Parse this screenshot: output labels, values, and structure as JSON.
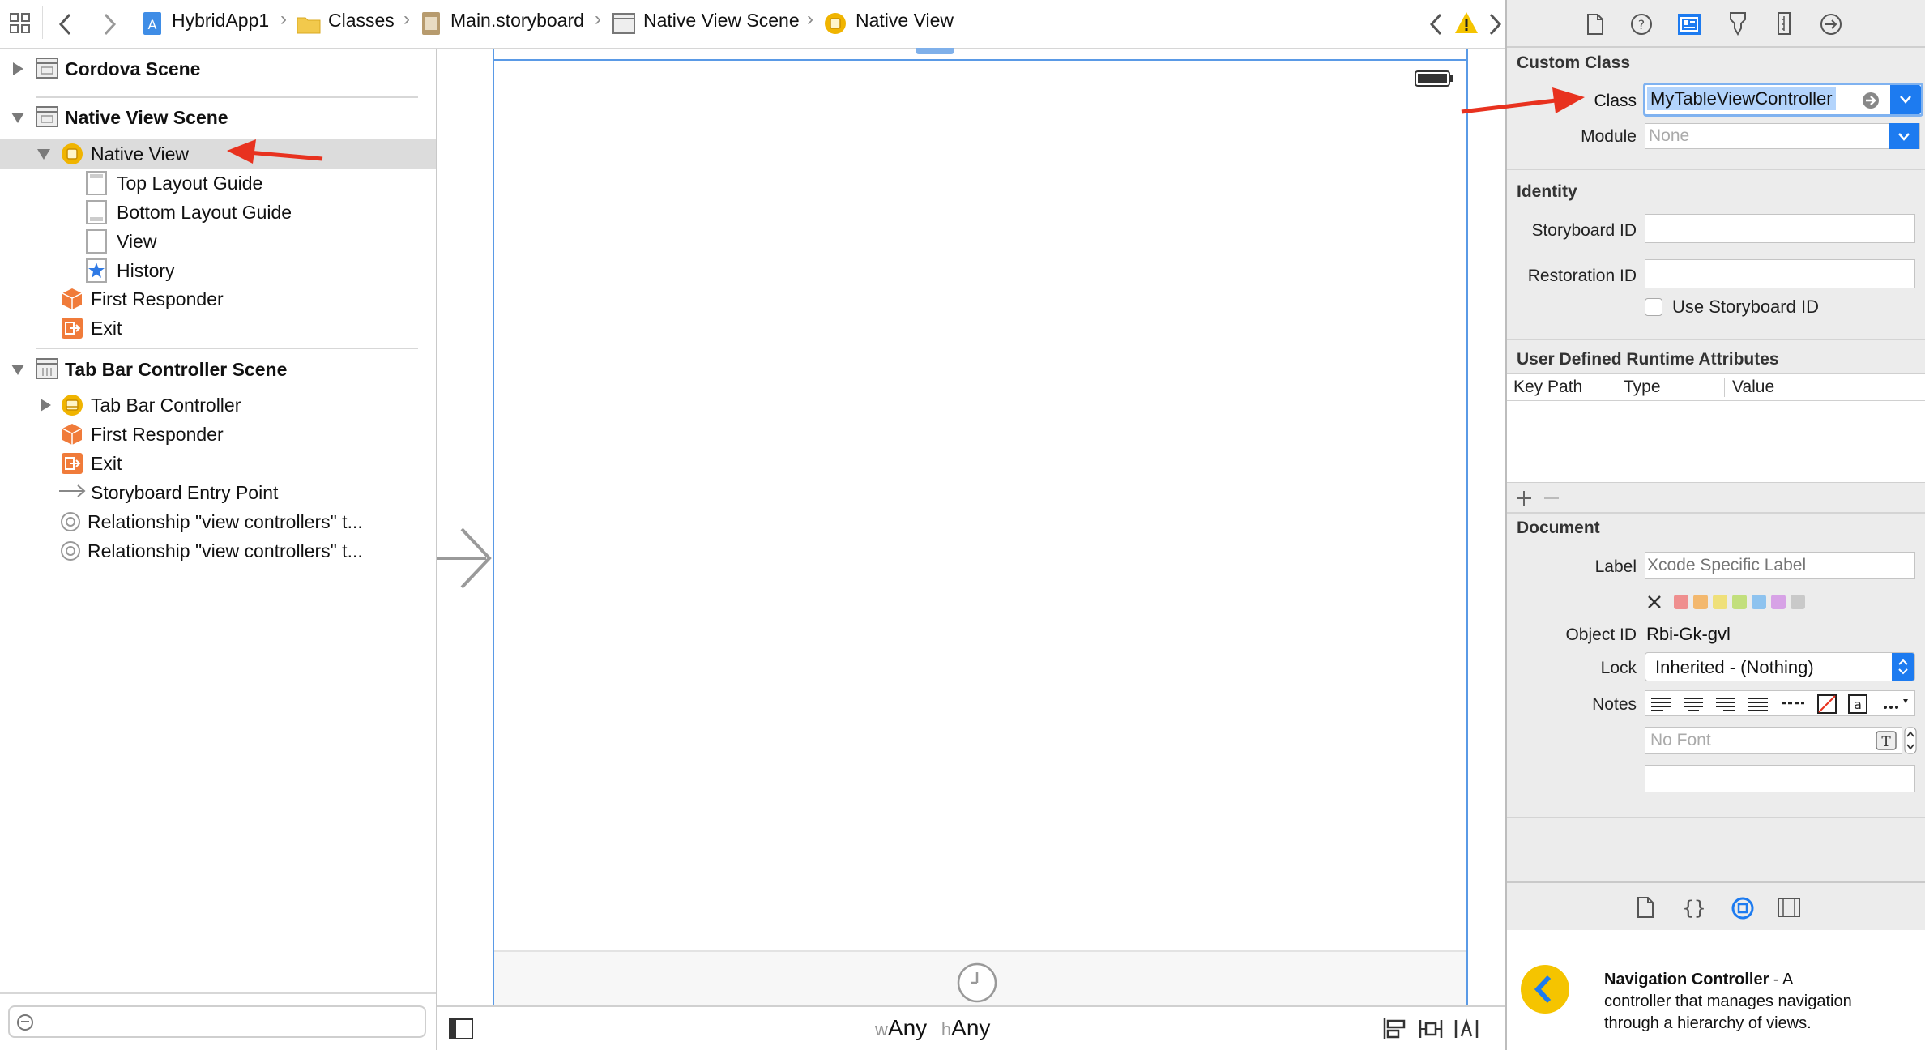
{
  "breadcrumb": {
    "items": [
      "HybridApp1",
      "Classes",
      "Main.storyboard",
      "Native View Scene",
      "Native View"
    ]
  },
  "outline": {
    "rows": [
      {
        "label": "Cordova Scene"
      },
      {
        "label": "Native View Scene"
      },
      {
        "label": "Native View"
      },
      {
        "label": "Top Layout Guide"
      },
      {
        "label": "Bottom Layout Guide"
      },
      {
        "label": "View"
      },
      {
        "label": "History"
      },
      {
        "label": "First Responder"
      },
      {
        "label": "Exit"
      },
      {
        "label": "Tab Bar Controller Scene"
      },
      {
        "label": "Tab Bar Controller"
      },
      {
        "label": "First Responder"
      },
      {
        "label": "Exit"
      },
      {
        "label": "Storyboard Entry Point"
      },
      {
        "label": "Relationship \"view controllers\" t..."
      },
      {
        "label": "Relationship \"view controllers\" t..."
      }
    ],
    "filter_placeholder": ""
  },
  "canvas": {
    "size_class_w": "w",
    "size_class_w_value": "Any",
    "size_class_h": "h",
    "size_class_h_value": "Any"
  },
  "inspector": {
    "custom_class": {
      "title": "Custom Class",
      "class_label": "Class",
      "class_value": "MyTableViewController",
      "module_label": "Module",
      "module_placeholder": "None"
    },
    "identity": {
      "title": "Identity",
      "storyboard_id_label": "Storyboard ID",
      "restoration_id_label": "Restoration ID",
      "use_storyboard_id_label": "Use Storyboard ID"
    },
    "runtime_attributes": {
      "title": "User Defined Runtime Attributes",
      "columns": [
        "Key Path",
        "Type",
        "Value"
      ]
    },
    "document": {
      "title": "Document",
      "label_label": "Label",
      "label_placeholder": "Xcode Specific Label",
      "object_id_label": "Object ID",
      "object_id_value": "Rbi-Gk-gvl",
      "lock_label": "Lock",
      "lock_value": "Inherited - (Nothing)",
      "notes_label": "Notes",
      "font_placeholder": "No Font",
      "swatch_colors": [
        "#ef8f8f",
        "#f3b86e",
        "#efe07a",
        "#c2df7c",
        "#8ec3ef",
        "#d7a2e6",
        "#c9c9c9"
      ]
    },
    "library_item": {
      "title": "Navigation Controller",
      "description_1": " - A",
      "description_2": "controller that manages navigation",
      "description_3": "through a hierarchy of views."
    }
  },
  "colors": {
    "accent": "#1d7bf0",
    "annotation_arrow": "#e8321f",
    "warning": "#f5c400",
    "controller_icon": "#f0b400"
  }
}
